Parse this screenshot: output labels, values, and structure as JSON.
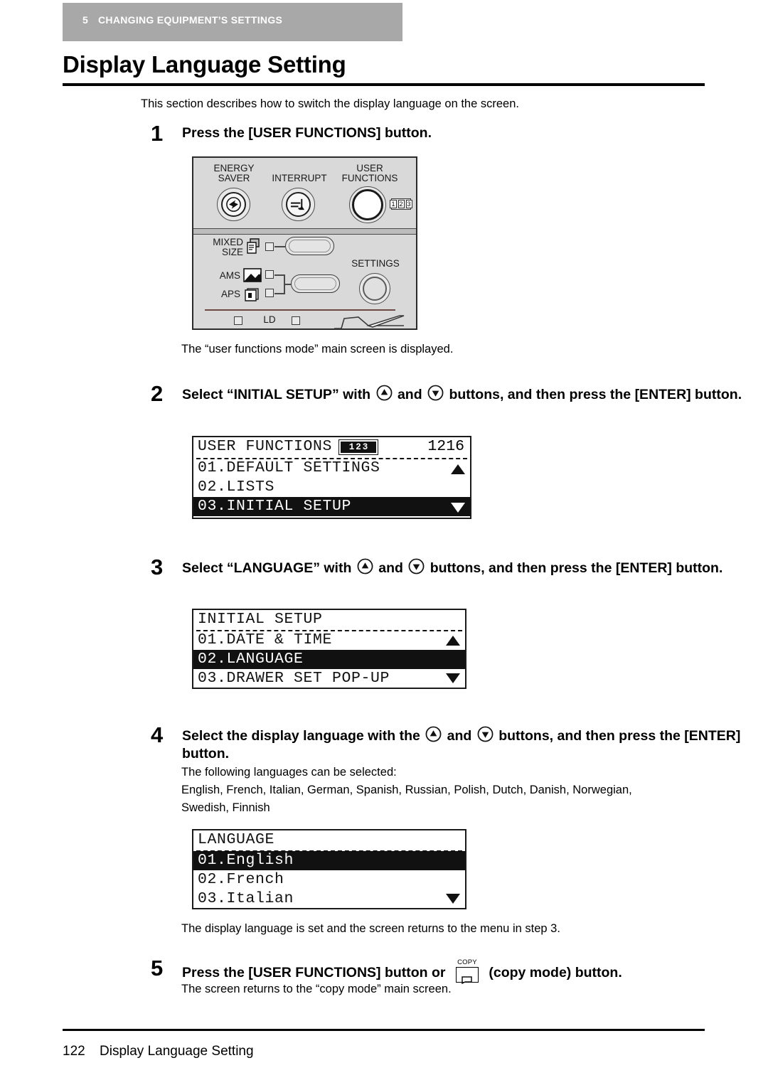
{
  "header": {
    "chapter_number": "5",
    "chapter_title": "CHANGING EQUIPMENT’S SETTINGS"
  },
  "page_title": "Display Language Setting",
  "intro": "This section describes how to switch the display language on the screen.",
  "steps": [
    {
      "number": "1",
      "heading": "Press the [USER FUNCTIONS] button.",
      "caption": "The “user functions mode” main screen is displayed."
    },
    {
      "number": "2",
      "heading_part1": "Select “INITIAL SETUP” with",
      "heading_part2": "and",
      "heading_part3": "buttons, and then press the [ENTER] button."
    },
    {
      "number": "3",
      "heading_part1": "Select “LANGUAGE” with",
      "heading_part2": "and",
      "heading_part3": "buttons, and then press the [ENTER] button."
    },
    {
      "number": "4",
      "heading_part1": "Select the display language with the",
      "heading_part2": "and",
      "heading_part3": "buttons, and then press the [ENTER] button.",
      "caption_line1": "The following languages can be selected:",
      "caption_line2": "English, French, Italian, German, Spanish, Russian, Polish, Dutch, Danish, Norwegian,",
      "caption_line3": "Swedish, Finnish",
      "after_caption": "The display language is set and the screen returns to the menu in step 3."
    },
    {
      "number": "5",
      "heading_part1": "Press the [USER FUNCTIONS] button or",
      "heading_part2": "(copy mode) button.",
      "copy_label": "COPY",
      "caption": "The screen returns to the “copy mode” main screen."
    }
  ],
  "control_panel": {
    "energy_saver_line1": "ENERGY",
    "energy_saver_line2": "SAVER",
    "interrupt": "INTERRUPT",
    "user_functions_line1": "USER",
    "user_functions_line2": "FUNCTIONS",
    "badge_digits": [
      "1",
      "2",
      "3"
    ],
    "mixed_size_line1": "MIXED",
    "mixed_size_line2": "SIZE",
    "ams": "AMS",
    "aps": "APS",
    "settings": "SETTINGS",
    "ld": "LD"
  },
  "lcd_screens": [
    {
      "title": "USER FUNCTIONS",
      "badge_digits": [
        "1",
        "2",
        "3"
      ],
      "counter": "1216",
      "rows": [
        {
          "text": "01.DEFAULT SETTINGS",
          "selected": false
        },
        {
          "text": "02.LISTS",
          "selected": false
        },
        {
          "text": "03.INITIAL SETUP",
          "selected": true
        }
      ]
    },
    {
      "title": "INITIAL SETUP",
      "rows": [
        {
          "text": "01.DATE & TIME",
          "selected": false
        },
        {
          "text": "02.LANGUAGE",
          "selected": true
        },
        {
          "text": "03.DRAWER SET POP-UP",
          "selected": false
        }
      ]
    },
    {
      "title": "LANGUAGE",
      "rows": [
        {
          "text": "01.English",
          "selected": true
        },
        {
          "text": "02.French",
          "selected": false
        },
        {
          "text": "03.Italian",
          "selected": false
        }
      ]
    }
  ],
  "footer": {
    "page_number": "122",
    "text": "Display Language Setting"
  }
}
